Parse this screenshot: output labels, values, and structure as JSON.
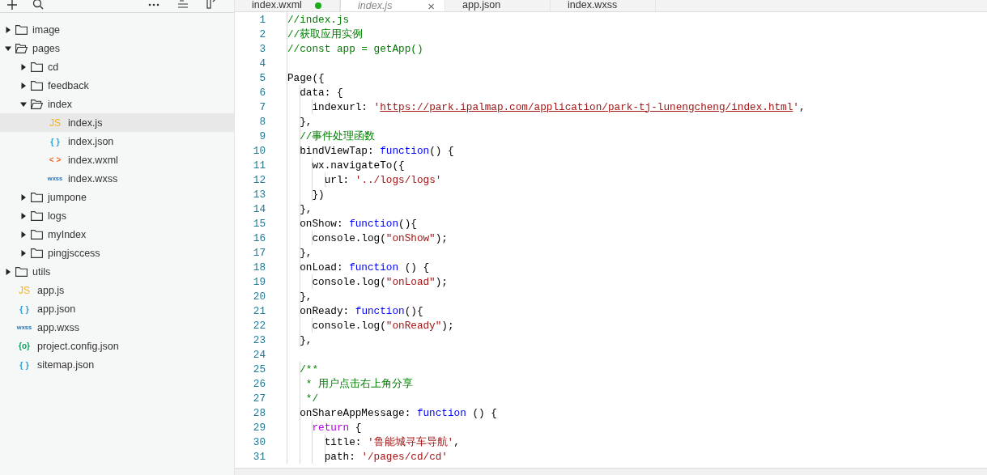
{
  "toolbar": {
    "buttons": [
      {
        "kind": "add"
      },
      {
        "kind": "search"
      },
      {
        "kind": "more"
      },
      {
        "kind": "collapse"
      },
      {
        "kind": "split"
      }
    ]
  },
  "explorer": {
    "items": [
      {
        "kind": "folder",
        "name": "image",
        "expanded": false,
        "selected": false
      },
      {
        "kind": "folder",
        "name": "pages",
        "expanded": true,
        "selected": false,
        "children": [
          {
            "kind": "folder",
            "name": "cd",
            "expanded": false,
            "selected": false
          },
          {
            "kind": "folder",
            "name": "feedback",
            "expanded": false,
            "selected": false
          },
          {
            "kind": "folder",
            "name": "index",
            "expanded": true,
            "selected": false,
            "children": [
              {
                "kind": "js",
                "badge": "JS",
                "name": "index.js",
                "selected": true
              },
              {
                "kind": "json",
                "badge": "{ }",
                "name": "index.json",
                "selected": false
              },
              {
                "kind": "wxml",
                "badge": "< >",
                "name": "index.wxml",
                "selected": false
              },
              {
                "kind": "wxss",
                "badge": "wxss",
                "name": "index.wxss",
                "selected": false
              }
            ]
          },
          {
            "kind": "folder",
            "name": "jumpone",
            "expanded": false,
            "selected": false
          },
          {
            "kind": "folder",
            "name": "logs",
            "expanded": false,
            "selected": false
          },
          {
            "kind": "folder",
            "name": "myIndex",
            "expanded": false,
            "selected": false
          },
          {
            "kind": "folder",
            "name": "pingjsccess",
            "expanded": false,
            "selected": false
          }
        ]
      },
      {
        "kind": "folder",
        "name": "utils",
        "expanded": false,
        "selected": false
      },
      {
        "kind": "js",
        "badge": "JS",
        "name": "app.js",
        "selected": false
      },
      {
        "kind": "json",
        "badge": "{ }",
        "name": "app.json",
        "selected": false
      },
      {
        "kind": "wxss",
        "badge": "wxss",
        "name": "app.wxss",
        "selected": false
      },
      {
        "kind": "config",
        "badge": "{o}",
        "name": "project.config.json",
        "selected": false
      },
      {
        "kind": "json",
        "badge": "{ }",
        "name": "sitemap.json",
        "selected": false
      }
    ]
  },
  "tabs": [
    {
      "label": "index.wxml",
      "selected": false,
      "modified": true
    },
    {
      "label": "index.js",
      "selected": true,
      "modified": false,
      "close": "×"
    },
    {
      "label": "app.json",
      "selected": false,
      "modified": false
    },
    {
      "label": "index.wxss",
      "selected": false,
      "modified": false
    }
  ],
  "editor": {
    "lines": [
      {
        "number": "1",
        "tokens": [
          {
            "kind": "comment",
            "text": "//index.js"
          }
        ]
      },
      {
        "number": "2",
        "tokens": [
          {
            "kind": "comment",
            "text": "//获取应用实例"
          }
        ]
      },
      {
        "number": "3",
        "tokens": [
          {
            "kind": "comment",
            "text": "//const app = getApp()"
          }
        ]
      },
      {
        "number": "4"
      },
      {
        "number": "5",
        "tokens": [
          {
            "kind": "plain",
            "text": "Page({"
          }
        ]
      },
      {
        "number": "6",
        "tokens": [
          {
            "kind": "plain",
            "text": "  data: {"
          }
        ]
      },
      {
        "number": "7",
        "tokens": [
          {
            "kind": "plain",
            "text": "    indexurl: "
          },
          {
            "kind": "string",
            "text": "'"
          },
          {
            "kind": "link",
            "text": "https://park.ipalmap.com/application/park-tj-lunengcheng/index.html"
          },
          {
            "kind": "string",
            "text": "'"
          },
          {
            "kind": "plain",
            "text": ","
          }
        ]
      },
      {
        "number": "8",
        "tokens": [
          {
            "kind": "plain",
            "text": "  },"
          }
        ]
      },
      {
        "number": "9",
        "tokens": [
          {
            "kind": "comment",
            "text": "  //事件处理函数"
          }
        ]
      },
      {
        "number": "10",
        "tokens": [
          {
            "kind": "plain",
            "text": "  bindViewTap: "
          },
          {
            "kind": "keyword",
            "text": "function"
          },
          {
            "kind": "plain",
            "text": "() {"
          }
        ]
      },
      {
        "number": "11",
        "tokens": [
          {
            "kind": "plain",
            "text": "    wx.navigateTo({"
          }
        ]
      },
      {
        "number": "12",
        "tokens": [
          {
            "kind": "plain",
            "text": "      url: "
          },
          {
            "kind": "string",
            "text": "'../logs/logs'"
          }
        ]
      },
      {
        "number": "13",
        "tokens": [
          {
            "kind": "plain",
            "text": "    })"
          }
        ]
      },
      {
        "number": "14",
        "tokens": [
          {
            "kind": "plain",
            "text": "  },"
          }
        ]
      },
      {
        "number": "15",
        "tokens": [
          {
            "kind": "plain",
            "text": "  onShow: "
          },
          {
            "kind": "keyword",
            "text": "function"
          },
          {
            "kind": "plain",
            "text": "(){"
          }
        ]
      },
      {
        "number": "16",
        "tokens": [
          {
            "kind": "plain",
            "text": "    console.log("
          },
          {
            "kind": "string",
            "text": "\"onShow\""
          },
          {
            "kind": "plain",
            "text": ");"
          }
        ]
      },
      {
        "number": "17",
        "tokens": [
          {
            "kind": "plain",
            "text": "  },"
          }
        ]
      },
      {
        "number": "18",
        "tokens": [
          {
            "kind": "plain",
            "text": "  onLoad: "
          },
          {
            "kind": "keyword",
            "text": "function"
          },
          {
            "kind": "plain",
            "text": " () {"
          }
        ]
      },
      {
        "number": "19",
        "tokens": [
          {
            "kind": "plain",
            "text": "    console.log("
          },
          {
            "kind": "string",
            "text": "\"onLoad\""
          },
          {
            "kind": "plain",
            "text": ");"
          }
        ]
      },
      {
        "number": "20",
        "tokens": [
          {
            "kind": "plain",
            "text": "  },"
          }
        ]
      },
      {
        "number": "21",
        "tokens": [
          {
            "kind": "plain",
            "text": "  onReady: "
          },
          {
            "kind": "keyword",
            "text": "function"
          },
          {
            "kind": "plain",
            "text": "(){"
          }
        ]
      },
      {
        "number": "22",
        "tokens": [
          {
            "kind": "plain",
            "text": "    console.log("
          },
          {
            "kind": "string",
            "text": "\"onReady\""
          },
          {
            "kind": "plain",
            "text": ");"
          }
        ]
      },
      {
        "number": "23",
        "tokens": [
          {
            "kind": "plain",
            "text": "  },"
          }
        ]
      },
      {
        "number": "24"
      },
      {
        "number": "25",
        "tokens": [
          {
            "kind": "comment",
            "text": "  /**"
          }
        ]
      },
      {
        "number": "26",
        "tokens": [
          {
            "kind": "comment",
            "text": "   * 用户点击右上角分享"
          }
        ]
      },
      {
        "number": "27",
        "tokens": [
          {
            "kind": "comment",
            "text": "   */"
          }
        ]
      },
      {
        "number": "28",
        "tokens": [
          {
            "kind": "plain",
            "text": "  onShareAppMessage: "
          },
          {
            "kind": "keyword",
            "text": "function"
          },
          {
            "kind": "plain",
            "text": " () {"
          }
        ]
      },
      {
        "number": "29",
        "tokens": [
          {
            "kind": "control",
            "text": "    return"
          },
          {
            "kind": "plain",
            "text": " {"
          }
        ]
      },
      {
        "number": "30",
        "tokens": [
          {
            "kind": "plain",
            "text": "      title: "
          },
          {
            "kind": "string",
            "text": "'鲁能城寻车导航'"
          },
          {
            "kind": "plain",
            "text": ","
          }
        ]
      },
      {
        "number": "31",
        "tokens": [
          {
            "kind": "plain",
            "text": "      path: "
          },
          {
            "kind": "string",
            "text": "'/pages/cd/cd'"
          }
        ]
      }
    ]
  }
}
